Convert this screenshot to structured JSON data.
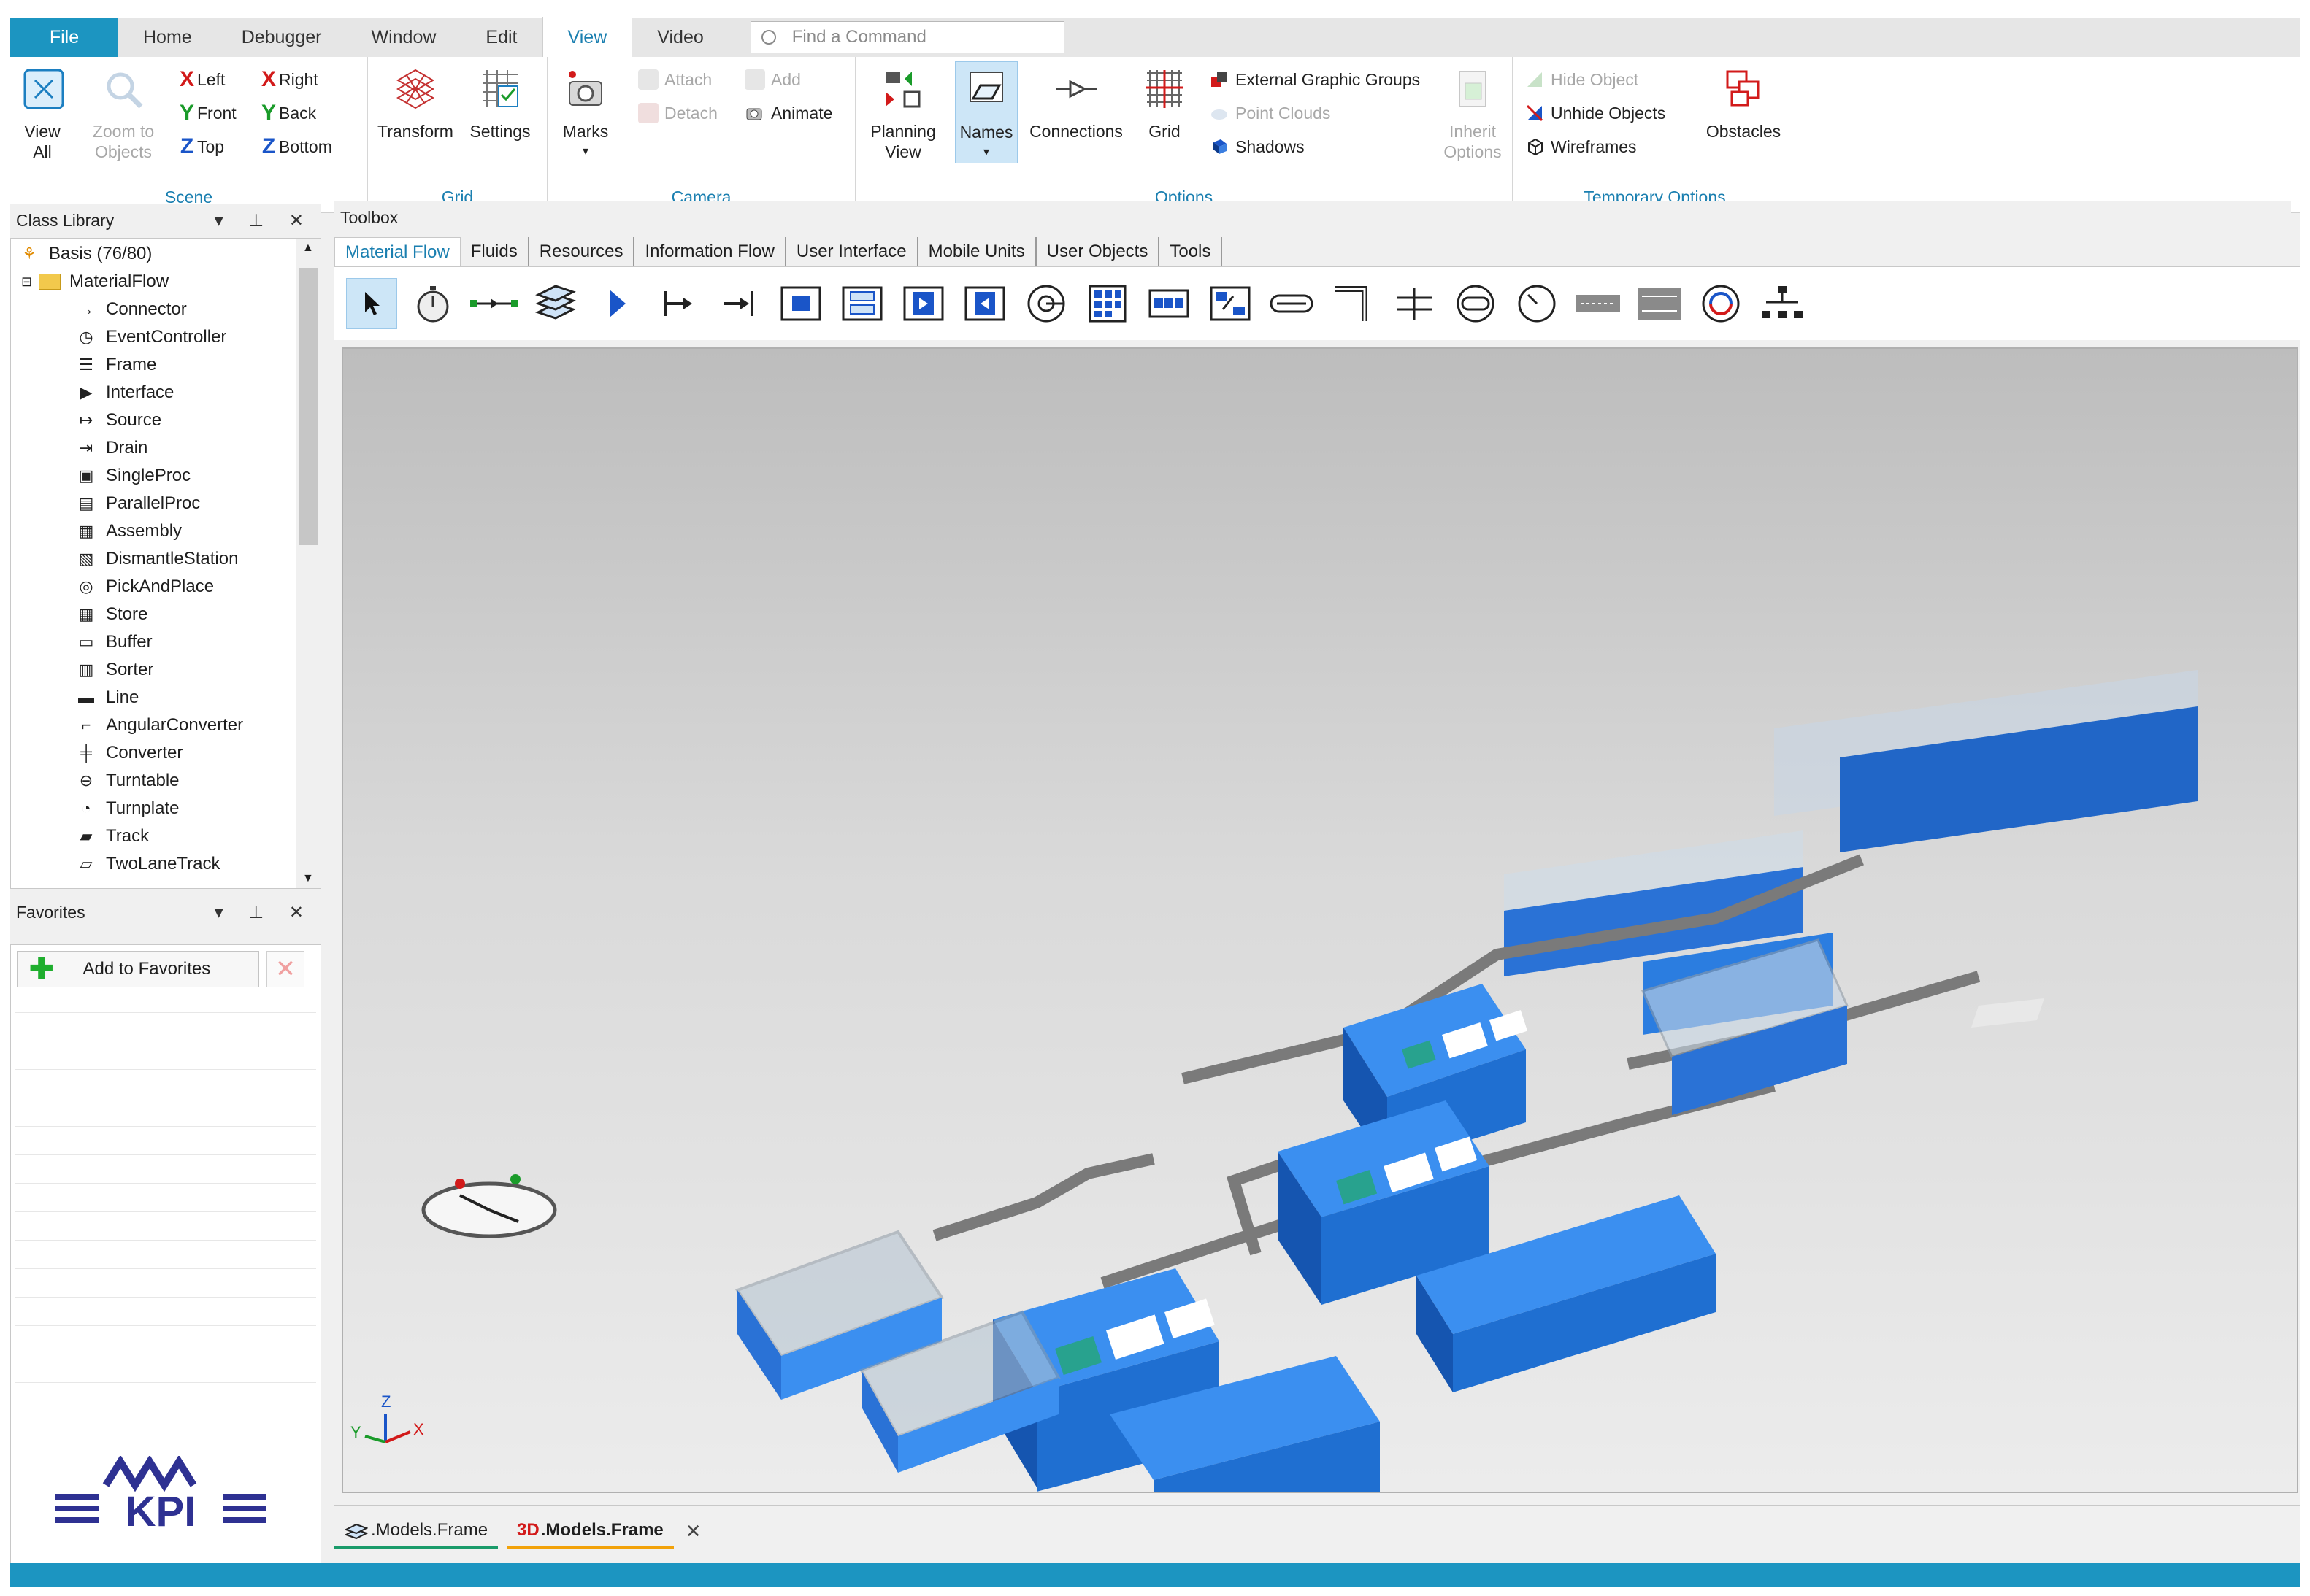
{
  "menubar": {
    "tabs": [
      {
        "label": "File"
      },
      {
        "label": "Home"
      },
      {
        "label": "Debugger"
      },
      {
        "label": "Window"
      },
      {
        "label": "Edit"
      },
      {
        "label": "View"
      },
      {
        "label": "Video"
      }
    ],
    "active_tab": "View",
    "search_placeholder": "Find a Command"
  },
  "ribbon": {
    "scene": {
      "label": "Scene",
      "view_all": "View\nAll",
      "zoom_to_objects": "Zoom to\nObjects",
      "left": "Left",
      "right": "Right",
      "front": "Front",
      "back": "Back",
      "top": "Top",
      "bottom": "Bottom"
    },
    "grid": {
      "label": "Grid",
      "transform": "Transform",
      "settings": "Settings"
    },
    "camera": {
      "label": "Camera",
      "marks": "Marks",
      "attach": "Attach",
      "detach": "Detach",
      "add": "Add",
      "animate": "Animate"
    },
    "options": {
      "label": "Options",
      "planning_view": "Planning\nView",
      "names": "Names",
      "connections": "Connections",
      "grid": "Grid",
      "external_graphic_groups": "External Graphic Groups",
      "point_clouds": "Point Clouds",
      "shadows": "Shadows",
      "inherit_options": "Inherit\nOptions"
    },
    "temporary_options": {
      "label": "Temporary Options",
      "hide_object": "Hide Object",
      "unhide_objects": "Unhide Objects",
      "wireframes": "Wireframes",
      "obstacles": "Obstacles"
    }
  },
  "class_library": {
    "title": "Class Library",
    "root": "Basis (76/80)",
    "folder": "MaterialFlow",
    "items": [
      {
        "label": "Connector",
        "icon": "connector-icon"
      },
      {
        "label": "EventController",
        "icon": "stopwatch-icon"
      },
      {
        "label": "Frame",
        "icon": "frame-icon"
      },
      {
        "label": "Interface",
        "icon": "interface-icon"
      },
      {
        "label": "Source",
        "icon": "source-icon"
      },
      {
        "label": "Drain",
        "icon": "drain-icon"
      },
      {
        "label": "SingleProc",
        "icon": "singleproc-icon"
      },
      {
        "label": "ParallelProc",
        "icon": "parallelproc-icon"
      },
      {
        "label": "Assembly",
        "icon": "assembly-icon"
      },
      {
        "label": "DismantleStation",
        "icon": "dismantle-icon"
      },
      {
        "label": "PickAndPlace",
        "icon": "pickandplace-icon"
      },
      {
        "label": "Store",
        "icon": "store-icon"
      },
      {
        "label": "Buffer",
        "icon": "buffer-icon"
      },
      {
        "label": "Sorter",
        "icon": "sorter-icon"
      },
      {
        "label": "Line",
        "icon": "line-icon"
      },
      {
        "label": "AngularConverter",
        "icon": "angular-converter-icon"
      },
      {
        "label": "Converter",
        "icon": "converter-icon"
      },
      {
        "label": "Turntable",
        "icon": "turntable-icon"
      },
      {
        "label": "Turnplate",
        "icon": "turnplate-icon"
      },
      {
        "label": "Track",
        "icon": "track-icon"
      },
      {
        "label": "TwoLaneTrack",
        "icon": "twolanetrack-icon"
      }
    ]
  },
  "favorites": {
    "title": "Favorites",
    "add_label": "Add to Favorites"
  },
  "toolbox": {
    "title": "Toolbox",
    "tabs": [
      "Material Flow",
      "Fluids",
      "Resources",
      "Information Flow",
      "User Interface",
      "Mobile Units",
      "User Objects",
      "Tools"
    ],
    "active_tab": "Material Flow"
  },
  "documents": {
    "tab1": ".Models.Frame",
    "tab2_prefix": "3D",
    "tab2": ".Models.Frame"
  },
  "logo_text": "KPI",
  "axes": {
    "x": "X",
    "y": "Y",
    "z": "Z"
  },
  "colors": {
    "accent": "#1c95c1",
    "machine_blue": "#1f6fd1"
  }
}
